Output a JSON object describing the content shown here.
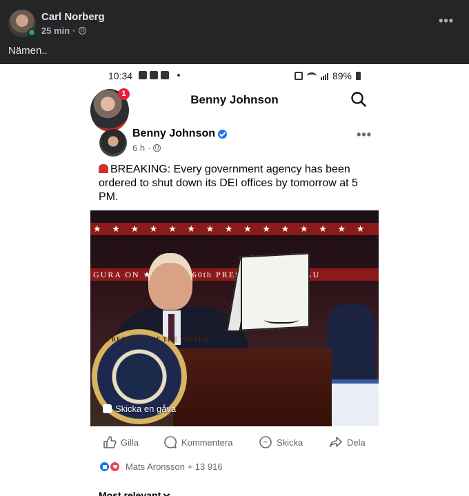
{
  "outer_post": {
    "author": "Carl Norberg",
    "time": "25 min",
    "text": "Nämen..",
    "privacy_icon": "globe-icon",
    "more_icon": "more-options-icon"
  },
  "status_bar": {
    "time": "10:34",
    "battery": "89%"
  },
  "page_header": {
    "title": "Benny Johnson",
    "notification_count": "1"
  },
  "post": {
    "author": "Benny Johnson",
    "verified": true,
    "time": "6 h",
    "text": "BREAKING: Every government agency has been ordered to shut down its DEI offices by tomorrow at 5 PM.",
    "gift_label": "Skicka en gåva",
    "image_banners": {
      "upper": "★ ★ ★ ★ ★ ★ ★ ★ ★ ★ ★ ★ ★ ★ ★",
      "lower": "GURA  ON  ★ ★ ★ ★  60th PRESIDENTIAL INAU"
    },
    "seal_text": "PRESIDENT OF THE UNITED"
  },
  "actions": {
    "like": "Gilla",
    "comment": "Kommentera",
    "send": "Skicka",
    "share": "Dela"
  },
  "reactions": {
    "summary": "Mats Aronsson + 13 916"
  },
  "comments": {
    "sort_label": "Most relevant"
  },
  "colors": {
    "dark_bg": "#242526",
    "accent": "#1877f2",
    "muted": "#65676b"
  }
}
